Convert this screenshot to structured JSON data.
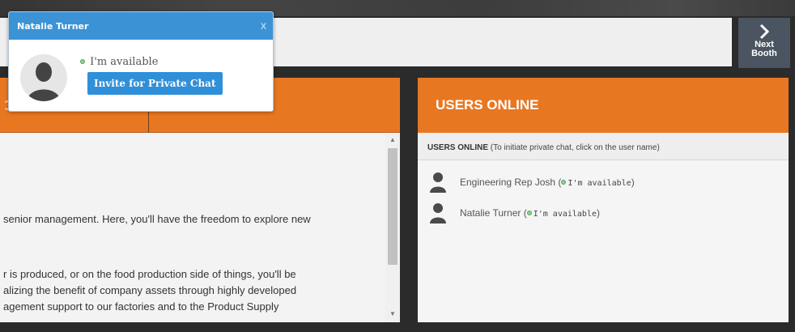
{
  "popup": {
    "user_name": "Natalie Turner",
    "close_glyph": "x",
    "status_text": "I'm available",
    "invite_label": "Invite for Private Chat"
  },
  "nav": {
    "next_label_line1": "Next",
    "next_label_line2": "Booth"
  },
  "content": {
    "para1": "senior management. Here, you'll have the freedom to explore new",
    "para2_lines": [
      "r is produced, or on the food production side of things, you'll be",
      "alizing the benefit of company assets through highly developed",
      "agement support to our factories and to the Product Supply"
    ]
  },
  "users_panel": {
    "title": "USERS ONLINE",
    "note_bold": "USERS ONLINE",
    "note_rest": " (To initiate private chat, click on the user name)",
    "users": [
      {
        "name": "Engineering Rep Josh",
        "status": "I'm available"
      },
      {
        "name": "Natalie Turner",
        "status": "I'm available"
      }
    ]
  },
  "colors": {
    "orange": "#e87722",
    "popup_blue": "#3b93d6",
    "available_green": "#8fcf8f"
  }
}
